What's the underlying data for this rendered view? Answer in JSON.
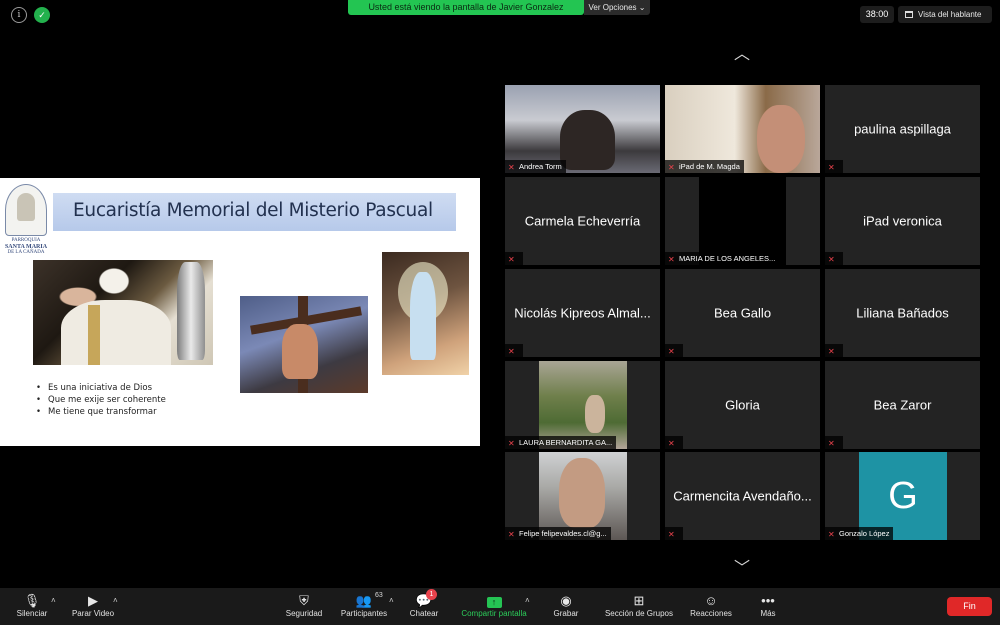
{
  "top": {
    "share_banner": "Usted está viendo la pantalla de Javier Gonzalez",
    "view_options": "Ver Opciones",
    "timer": "38:00",
    "speaker_view": "Vista del hablante"
  },
  "slide": {
    "logo_caption_1": "PARROQUIA",
    "logo_caption_2": "SANTA MARIA",
    "logo_caption_3": "DE LA CAÑADA",
    "title": "Eucaristía Memorial del Misterio Pascual",
    "bullets": [
      "Es una iniciativa de Dios",
      "Que me exije ser coherente",
      "Me tiene que transformar"
    ]
  },
  "gallery": {
    "tiles": [
      {
        "name": "Andrea Torm"
      },
      {
        "name": "iPad de M. Magda"
      },
      {
        "name": "paulina aspillaga"
      },
      {
        "name": "Carmela Echeverría"
      },
      {
        "name": "MARIA DE LOS ANGELES..."
      },
      {
        "name": "iPad veronica"
      },
      {
        "name": "Nicolás Kipreos Almal..."
      },
      {
        "name": "Bea Gallo"
      },
      {
        "name": "Liliana Bañados"
      },
      {
        "name": "LAURA BERNARDITA GA..."
      },
      {
        "name": "Gloria"
      },
      {
        "name": "Bea Zaror"
      },
      {
        "name": "Felipe felipevaldes.cl@g..."
      },
      {
        "name": "Carmencita Avendaño..."
      },
      {
        "name": "Gonzalo López",
        "initial": "G",
        "avatar_color": "#1e93a4"
      }
    ]
  },
  "toolbar": {
    "mute": "Silenciar",
    "stop_video": "Parar Video",
    "security": "Seguridad",
    "participants": "Participantes",
    "participants_count": "63",
    "chat": "Chatear",
    "chat_badge": "1",
    "share": "Compartir pantalla",
    "record": "Grabar",
    "breakout": "Sección de Grupos",
    "reactions": "Reacciones",
    "more": "Más",
    "end": "Fin"
  },
  "colors": {
    "accent_green": "#23c552",
    "end_red": "#e02828",
    "tile_bg": "#232323",
    "mic_off_red": "#e8424c"
  }
}
